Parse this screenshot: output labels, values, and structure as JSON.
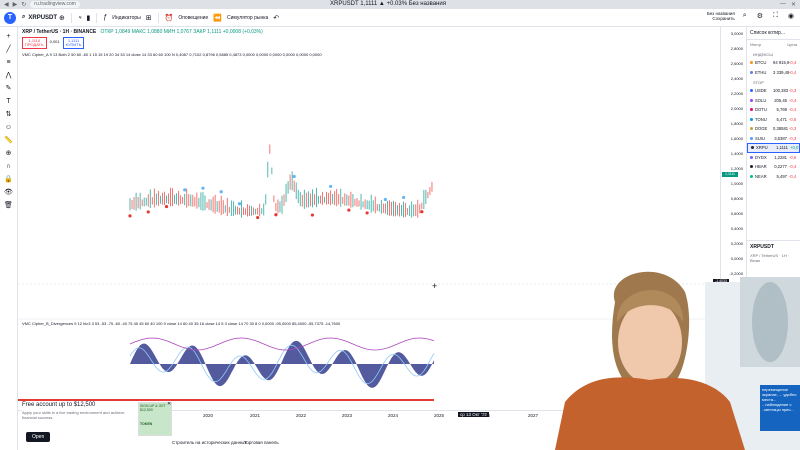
{
  "browser": {
    "url": "ru.tradingview.com",
    "window_title": "XRPUSDT 1,1111 ▲ +0.03% Без названия"
  },
  "toolbar": {
    "symbol": "XRPUSDT",
    "indicators_label": "Индикаторы",
    "alert_label": "Оповещение",
    "replay_label": "Симулятор рынка",
    "save_label": "Без названия",
    "save_sub": "Сохранить"
  },
  "legend": {
    "pair": "XRP / TetherUS · 1Н · BINANCE",
    "ohlc": "ОТКР 1,0849  МАКС 1,0880  МИН 1,0767  ЗАКР 1,1111  +0,0008 (+0,03%)",
    "sell_price": "1,1110",
    "sell_label": "ПРОДАТЬ",
    "spread": "0,001",
    "buy_price": "1,1111",
    "buy_label": "КУПИТЬ"
  },
  "indicator1": {
    "text": "VMC Cipher_A 9 13 Both 2 50 60 -60 1 15 15 19 20 34 33 14 close 14 33 60 60 100 N 0,4087 0,7102 0,8796 0,5885 0,4873 0,0000 0,0000 0,0000 0,0000 0,0000 0,0000"
  },
  "indicator2": {
    "text": "VMC Cipher_B_Divergences 9 12 hlc3 3 53 -53 -75 -60 -40 75 45 45 60 40 100 9 close 14 60 40 35 16 close 14 5 3 close 14 70 30 8 0 0,0000 -95,0000 85,4000 -55,7375 -14,7600"
  },
  "price_axis": {
    "ticks": [
      "3,0000",
      "2,8000",
      "2,6000",
      "2,4000",
      "2,2000",
      "2,0000",
      "1,8000",
      "1,6000",
      "1,4000",
      "1,2000",
      "1,0000",
      "0,8000",
      "0,6000",
      "0,4000",
      "0,2000",
      "0,0000",
      "-0,2000"
    ],
    "current_price": "1,1111",
    "current_color": "#089981",
    "crosshair_value": "-1,4033",
    "osc_value": "-0,0000"
  },
  "time_axis": {
    "labels": [
      "2020",
      "2021",
      "2022",
      "2023",
      "2024",
      "2025",
      "2026",
      "2027"
    ],
    "cursor_label": "ср 13 Окт '25"
  },
  "bottom": {
    "history_label": "Строитель на исторических данных",
    "trading_panel": "Торговая панель"
  },
  "ad": {
    "title": "Free account up to $12,500",
    "body": "Apply your skills in a live trading environment and achieve financial success.",
    "cta": "Open",
    "thumb_text": "SIGN UP & GET $12,500",
    "brand": "TOKEN"
  },
  "watchlist": {
    "title": "Список котир...",
    "col_symbol": "Инстр",
    "col_last": "Цена",
    "groups": [
      {
        "name": "ИНДЕКСЫ",
        "rows": [
          {
            "sym": "BTCU",
            "last": "94 915,9",
            "chg": "-0,4",
            "dot": "#f7931a"
          },
          {
            "sym": "ETHU",
            "last": "3 339,49",
            "chg": "-0,4",
            "dot": "#627eea"
          }
        ]
      },
      {
        "name": "STOP",
        "rows": [
          {
            "sym": "USDE",
            "last": "100,383",
            "chg": "-0,3",
            "dot": "#2962ff"
          },
          {
            "sym": "SOLU",
            "last": "205,45",
            "chg": "-0,4",
            "dot": "#9945ff"
          },
          {
            "sym": "DOTU",
            "last": "5,769",
            "chg": "-0,4",
            "dot": "#e6007a"
          },
          {
            "sym": "TONU",
            "last": "5,471",
            "chg": "-0,5",
            "dot": "#0098ea"
          },
          {
            "sym": "DOGE",
            "last": "0,38581",
            "chg": "-0,3",
            "dot": "#c2a633"
          },
          {
            "sym": "SUIU",
            "last": "3,6387",
            "chg": "-0,3",
            "dot": "#4da2ff"
          },
          {
            "sym": "XRPU",
            "last": "1,1111",
            "chg": "+0,0",
            "dot": "#23292f",
            "selected": true
          },
          {
            "sym": "DYDX",
            "last": "1,2281",
            "chg": "-0,6",
            "dot": "#6966ff"
          },
          {
            "sym": "HBAR",
            "last": "0,2277",
            "chg": "-0,4",
            "dot": "#222222"
          },
          {
            "sym": "NEAR",
            "last": "5,497",
            "chg": "-0,4",
            "dot": "#00c08b"
          }
        ]
      }
    ]
  },
  "detail": {
    "symbol": "XRPUSDT",
    "name": "XRP / TetherUS · 1Н · Binan"
  },
  "webcam_caption": "перемещение экранах, ... удобно места... ...наблюдение с ..ментацы прич..."
}
